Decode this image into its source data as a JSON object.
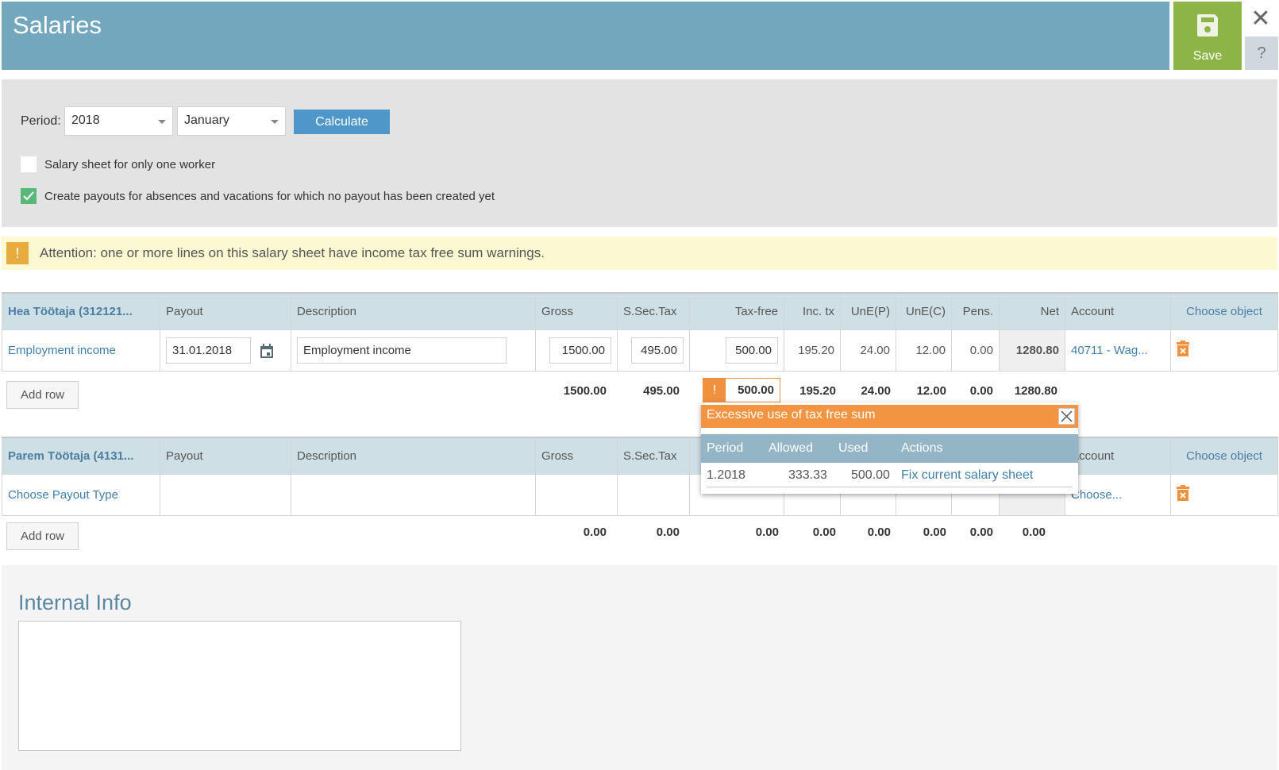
{
  "header": {
    "title": "Salaries",
    "save_label": "Save",
    "close_icon": "close-icon",
    "help_label": "?"
  },
  "colors": {
    "header": "#73a7bd",
    "save": "#8db446",
    "calculate": "#4f97c8",
    "warning_bg": "#fbf8d2",
    "warning_icon": "#e7ab3e",
    "popup_header": "#f29442",
    "link": "#3f7fab"
  },
  "filter": {
    "period_label": "Period:",
    "year_value": "2018",
    "month_value": "January",
    "calculate_label": "Calculate",
    "checkboxes": [
      {
        "label": "Salary sheet for only one worker",
        "checked": false
      },
      {
        "label": "Create payouts for absences and vacations for which no payout has been created yet",
        "checked": true
      }
    ]
  },
  "warning": {
    "icon": "!",
    "text": "Attention: one or more lines on this salary sheet have income tax free sum warnings."
  },
  "columns": [
    "Payout",
    "Description",
    "Gross",
    "S.Sec.Tax",
    "Tax-free",
    "Inc. tx",
    "UnE(P)",
    "UnE(C)",
    "Pens.",
    "Net",
    "Account",
    "Choose object"
  ],
  "workers": [
    {
      "name": "Hea Töötaja (312121...",
      "row": {
        "type": "Employment income",
        "payout_date": "31.01.2018",
        "description": "Employment income",
        "gross": "1500.00",
        "ssec": "495.00",
        "taxfree": "500.00",
        "inctx": "195.20",
        "unep": "24.00",
        "unec": "12.00",
        "pens": "0.00",
        "net": "1280.80",
        "account": "40711 - Wag..."
      },
      "add_row_label": "Add row",
      "totals": {
        "gross": "1500.00",
        "ssec": "495.00",
        "taxfree": "500.00",
        "inctx": "195.20",
        "unep": "24.00",
        "unec": "12.00",
        "pens": "0.00",
        "net": "1280.80"
      }
    },
    {
      "name": "Parem Töötaja (4131...",
      "row": {
        "type": "Choose Payout Type",
        "account": "Choose..."
      },
      "add_row_label": "Add row",
      "totals": {
        "gross": "0.00",
        "ssec": "0.00",
        "taxfree": "0.00",
        "inctx": "0.00",
        "unep": "0.00",
        "unec": "0.00",
        "pens": "0.00",
        "net": "0.00"
      }
    }
  ],
  "popup": {
    "title": "Excessive use of tax free sum",
    "headers": [
      "Period",
      "Allowed",
      "Used",
      "Actions"
    ],
    "row": {
      "period": "1.2018",
      "allowed": "333.33",
      "used": "500.00",
      "action": "Fix current salary sheet"
    }
  },
  "internal_info": {
    "title": "Internal Info",
    "value": ""
  }
}
